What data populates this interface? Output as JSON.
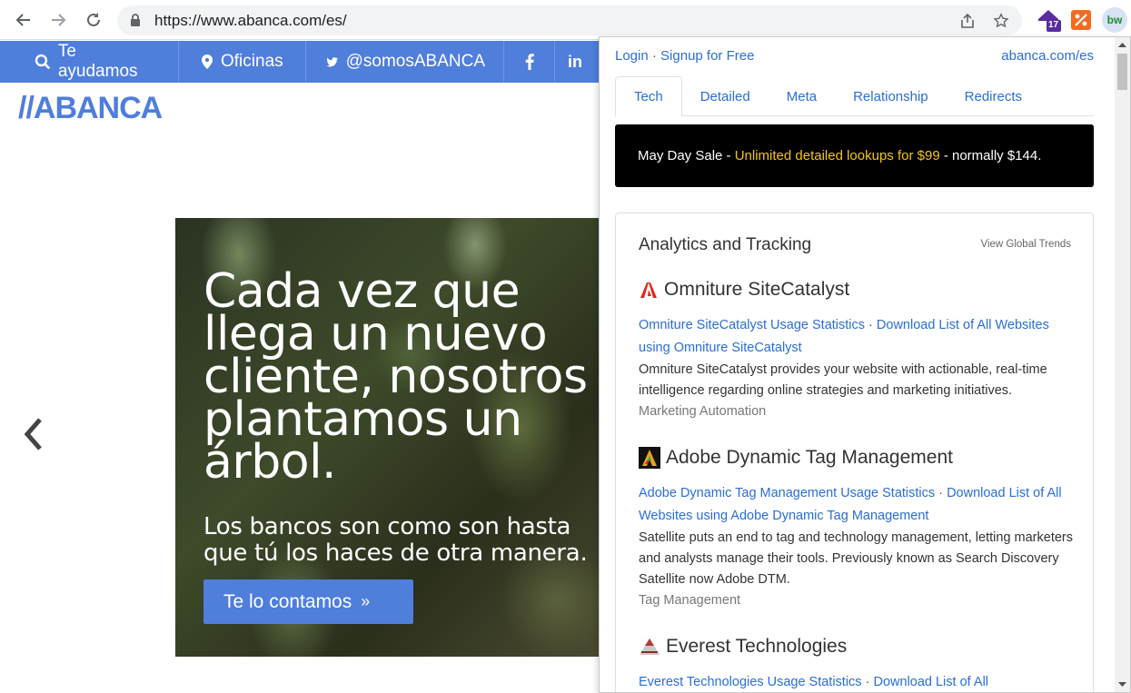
{
  "browser": {
    "url": "https://www.abanca.com/es/",
    "extension_badge": "17",
    "ext_bw_label": "bw"
  },
  "site": {
    "nav": [
      {
        "label": "Te ayudamos",
        "icon": "search-icon"
      },
      {
        "label": "Oficinas",
        "icon": "map-pin-icon"
      },
      {
        "label": "@somosABANCA",
        "icon": "twitter-icon"
      },
      {
        "label": "",
        "icon": "facebook-icon"
      },
      {
        "label": "",
        "icon": "linkedin-icon"
      }
    ],
    "logo": "//ABANCA",
    "hero_title_lines": [
      "Cada vez que",
      "llega un nuevo",
      "cliente, nosotros",
      "plantamos un",
      "árbol."
    ],
    "hero_sub_lines": [
      "Los bancos son como son hasta",
      "que tú los haces de otra manera."
    ],
    "hero_button": "Te lo contamos"
  },
  "popup": {
    "login": "Login",
    "separator": "·",
    "signup": "Signup for Free",
    "domain": "abanca.com/es",
    "tabs": [
      "Tech",
      "Detailed",
      "Meta",
      "Relationship",
      "Redirects"
    ],
    "active_tab": "Tech",
    "banner": {
      "prefix": "May Day Sale - ",
      "highlight": "Unlimited detailed lookups for $99",
      "suffix": " - normally $144."
    },
    "section": {
      "title": "Analytics and Tracking",
      "trends": "View Global Trends",
      "techs": [
        {
          "name": "Omniture SiteCatalyst",
          "icon": "adobe-icon",
          "usage_link": "Omniture SiteCatalyst Usage Statistics",
          "download_link": "Download List of All Websites using Omniture SiteCatalyst",
          "description": "Omniture SiteCatalyst provides your website with actionable, real-time intelligence regarding online strategies and marketing initiatives.",
          "category": "Marketing Automation"
        },
        {
          "name": "Adobe Dynamic Tag Management",
          "icon": "adobe-dtm-icon",
          "usage_link": "Adobe Dynamic Tag Management Usage Statistics",
          "download_link": "Download List of All Websites using Adobe Dynamic Tag Management",
          "description": "Satellite puts an end to tag and technology management, letting marketers and analysts manage their tools. Previously known as Search Discovery Satellite now Adobe DTM.",
          "category": "Tag Management"
        },
        {
          "name": "Everest Technologies",
          "icon": "everest-icon",
          "usage_link": "Everest Technologies Usage Statistics",
          "download_link": "Download List of All",
          "description": "",
          "category": ""
        }
      ]
    }
  }
}
